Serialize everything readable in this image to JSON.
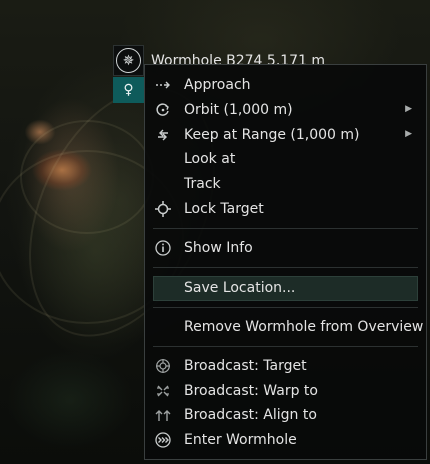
{
  "target": {
    "label": "Wormhole B274  5,171 m",
    "icon": "wormhole-icon",
    "fleet_icon": "person-icon"
  },
  "menu": {
    "items": [
      {
        "label": "Approach",
        "icon": "approach-icon",
        "submenu": false
      },
      {
        "label": "Orbit (1,000 m)",
        "icon": "orbit-icon",
        "submenu": true
      },
      {
        "label": "Keep at Range (1,000 m)",
        "icon": "keep-at-range-icon",
        "submenu": true
      },
      {
        "label": "Look at",
        "icon": "",
        "submenu": false
      },
      {
        "label": "Track",
        "icon": "",
        "submenu": false
      },
      {
        "label": "Lock Target",
        "icon": "crosshair-icon",
        "submenu": false
      },
      {
        "label": "Show Info",
        "icon": "info-icon",
        "submenu": false
      },
      {
        "label": "Save Location...",
        "icon": "",
        "submenu": false,
        "highlighted": true
      },
      {
        "label": "Remove Wormhole from Overview",
        "icon": "",
        "submenu": false
      },
      {
        "label": "Broadcast: Target",
        "icon": "broadcast-target-icon",
        "submenu": false
      },
      {
        "label": "Broadcast: Warp to",
        "icon": "broadcast-warp-icon",
        "submenu": false
      },
      {
        "label": "Broadcast: Align to",
        "icon": "broadcast-align-icon",
        "submenu": false
      },
      {
        "label": "Enter Wormhole",
        "icon": "enter-wormhole-icon",
        "submenu": false
      }
    ]
  },
  "colors": {
    "menu_bg": "#090a0a",
    "highlight": "#1d2c27",
    "text": "#e4e4e4",
    "fleet_accent": "#0e5b5b"
  }
}
